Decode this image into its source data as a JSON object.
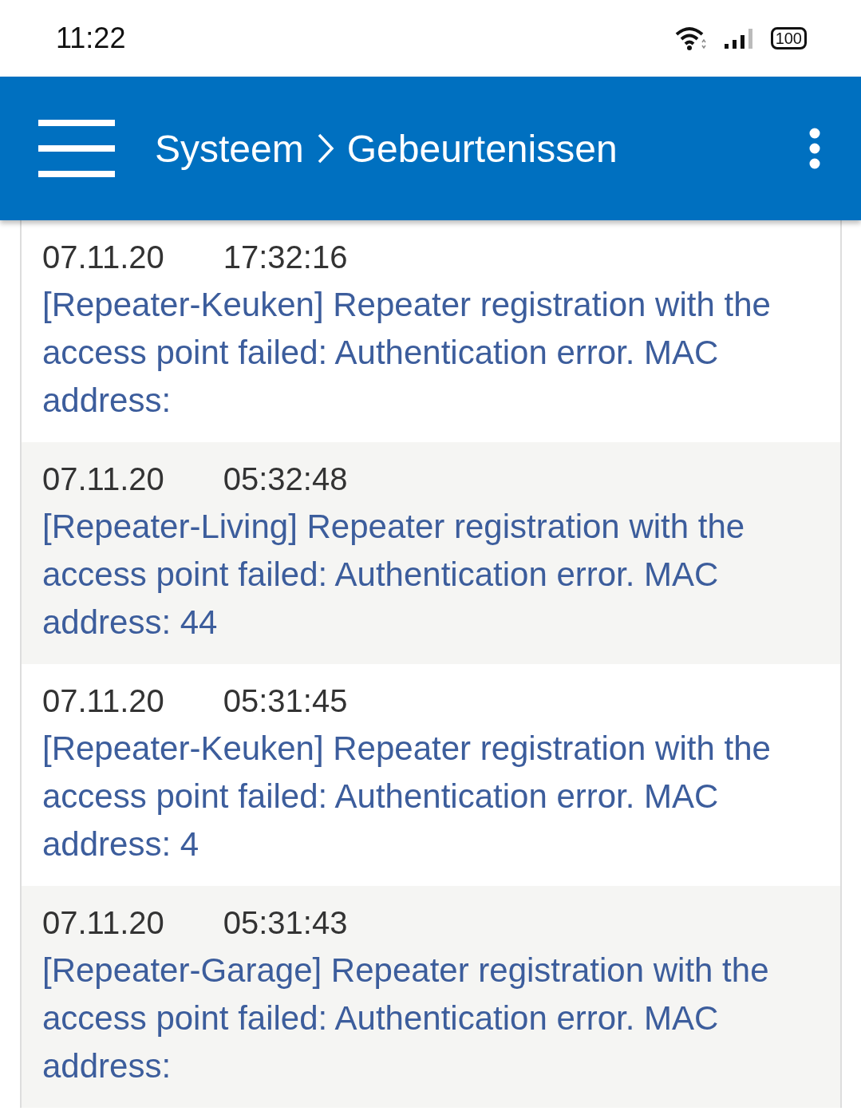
{
  "status_bar": {
    "time": "11:22",
    "battery": "100"
  },
  "app_bar": {
    "breadcrumb": [
      {
        "label": "Systeem"
      },
      {
        "label": "Gebeurtenissen"
      }
    ]
  },
  "events": [
    {
      "date": "07.11.20",
      "time": "17:32:16",
      "message": "[Repeater-Keuken] Repeater registration with the access point failed: Authentication error. MAC address:"
    },
    {
      "date": "07.11.20",
      "time": "05:32:48",
      "message": "[Repeater-Living] Repeater registration with the access point failed: Authentication error. MAC address: 44"
    },
    {
      "date": "07.11.20",
      "time": "05:31:45",
      "message": "[Repeater-Keuken] Repeater registration with the access point failed: Authentication error. MAC address: 4"
    },
    {
      "date": "07.11.20",
      "time": "05:31:43",
      "message": "[Repeater-Garage] Repeater registration with the access point failed: Authentication error. MAC address:"
    }
  ]
}
